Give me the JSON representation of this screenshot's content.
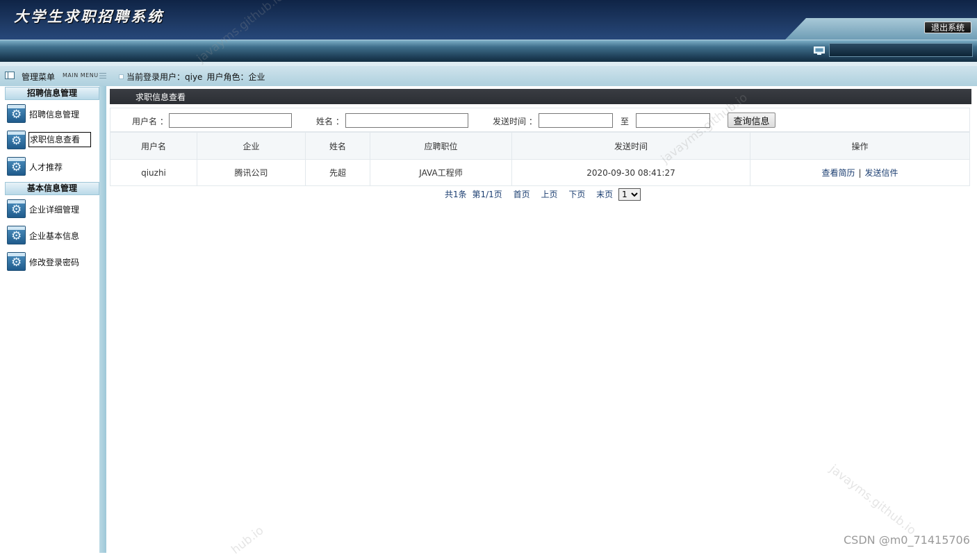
{
  "header": {
    "app_title": "大学生求职招聘系统",
    "logout_label": "退出系统"
  },
  "sidebar": {
    "menu_title": "管理菜单",
    "menu_subtitle": "MAIN MENU",
    "groups": [
      {
        "title": "招聘信息管理",
        "items": [
          "招聘信息管理",
          "求职信息查看",
          "人才推荐"
        ]
      },
      {
        "title": "基本信息管理",
        "items": [
          "企业详细管理",
          "企业基本信息",
          "修改登录密码"
        ]
      }
    ]
  },
  "status": {
    "user_label": "当前登录用户：qiye",
    "role_label": "用户角色：企业"
  },
  "panel": {
    "title": "求职信息查看"
  },
  "search": {
    "username_label": "用户名 ：",
    "name_label": "姓名 ：",
    "time_label": "发送时间 ：",
    "to_label": "至",
    "button_label": "查询信息"
  },
  "table": {
    "headers": [
      "用户名",
      "企业",
      "姓名",
      "应聘职位",
      "发送时间",
      "操作"
    ],
    "rows": [
      {
        "username": "qiuzhi",
        "company": "腾讯公司",
        "name": "先超",
        "position": "JAVA工程师",
        "time": "2020-09-30 08:41:27",
        "action1": "查看简历",
        "separator": "|",
        "action2": "发送信件"
      }
    ]
  },
  "pager": {
    "total": "共1条",
    "page": "第1/1页",
    "first": "首页",
    "prev": "上页",
    "next": "下页",
    "last": "末页",
    "selected": "1"
  },
  "watermarks": [
    "javayms.github.io",
    "javayms.github.io",
    "javayms.github.io",
    "hub.io"
  ],
  "footer_watermark": "CSDN @m0_71415706",
  "colors": {
    "header_dark": "#0f2446",
    "panel_title": "#2b2e33",
    "link": "#1a3d70"
  }
}
